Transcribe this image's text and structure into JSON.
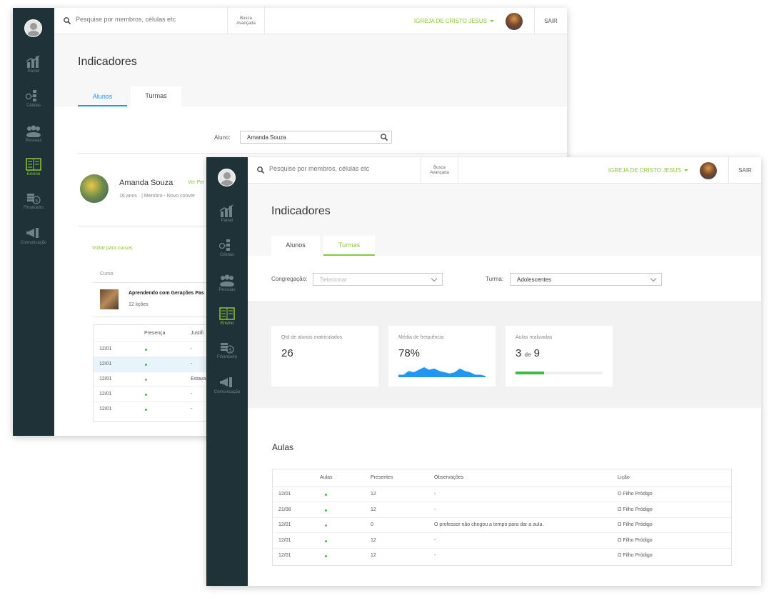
{
  "colors": {
    "sidebar": "#1e3238",
    "accent_green": "#8dc63f",
    "accent_blue": "#2196f3",
    "sparkline": "#2196f3",
    "dot_green": "#3dbb3d"
  },
  "sidebar": {
    "items": [
      {
        "label": "Painel",
        "icon": "chart-icon"
      },
      {
        "label": "Células",
        "icon": "cells-icon"
      },
      {
        "label": "Pessoas",
        "icon": "people-icon"
      },
      {
        "label": "Ensino",
        "icon": "book-icon",
        "active": true
      },
      {
        "label": "Financeiro",
        "icon": "money-icon"
      },
      {
        "label": "Comunicação",
        "icon": "megaphone-icon"
      }
    ]
  },
  "topbar": {
    "search_placeholder": "Pesquise por membros, células etc",
    "adv_line1": "Busca",
    "adv_line2": "Avançada",
    "church": "IGREJA DE CRISTO JESUS",
    "logout": "SAIR"
  },
  "back": {
    "title": "Indicadores",
    "tabs": [
      "Alunos",
      "Turmas"
    ],
    "aluno_label": "Aluno:",
    "aluno_value": "Amanda Souza",
    "student": {
      "name": "Amanda Souza",
      "link": "Ver Per",
      "meta": "16 anos · | Membro - Novo conver"
    },
    "back_link": "Voltar para cursos",
    "course_header": "Curso",
    "course_title": "Aprendendo com Gerações Pas",
    "course_lessons": "12 lições",
    "table_headers": [
      "Presença",
      "Justifi"
    ],
    "rows": [
      {
        "date": "12/01",
        "dot": "green",
        "just": "-"
      },
      {
        "date": "12/01",
        "dot": "green",
        "just": "-",
        "highlight": true
      },
      {
        "date": "12/01",
        "dot": "grey",
        "just": "Estava"
      },
      {
        "date": "12/01",
        "dot": "green",
        "just": "-"
      },
      {
        "date": "12/01",
        "dot": "green",
        "just": "-"
      }
    ]
  },
  "front": {
    "title": "Indicadores",
    "tabs": [
      "Alunos",
      "Turmas"
    ],
    "congregacao_label": "Congregação:",
    "congregacao_placeholder": "Selecionar",
    "turma_label": "Turma:",
    "turma_value": "Adolescentes",
    "stats": {
      "alunos_label": "Qtd de alunos matriculados",
      "alunos_value": "26",
      "freq_label": "Média de frequência",
      "freq_value": "78%",
      "aulas_label": "Aulas realizadas",
      "aulas_done": "3",
      "aulas_de": "de",
      "aulas_total": "9",
      "aulas_progress": 0.33
    },
    "sparkline_values": [
      2,
      2,
      5,
      4,
      6,
      8,
      6,
      7,
      5,
      4,
      3,
      4,
      7,
      5,
      4,
      2,
      2,
      1
    ],
    "aulas_title": "Aulas",
    "table_headers": [
      "Aulas",
      "Presentes",
      "Observações",
      "Lição"
    ],
    "rows": [
      {
        "date": "12/01",
        "dot": "green",
        "presentes": "12",
        "obs": "-",
        "licao": "O Filho Pródigo"
      },
      {
        "date": "21/08",
        "dot": "green",
        "presentes": "12",
        "obs": "-",
        "licao": "O Filho Pródigo"
      },
      {
        "date": "12/01",
        "dot": "grey",
        "presentes": "0",
        "obs": "O professor não chegou a tempo para dar a aula.",
        "licao": "O Filho Pródigo"
      },
      {
        "date": "12/01",
        "dot": "green",
        "presentes": "12",
        "obs": "-",
        "licao": "O Filho Pródigo"
      },
      {
        "date": "12/01",
        "dot": "green",
        "presentes": "12",
        "obs": "-",
        "licao": "O Filho Pródigo"
      }
    ]
  }
}
